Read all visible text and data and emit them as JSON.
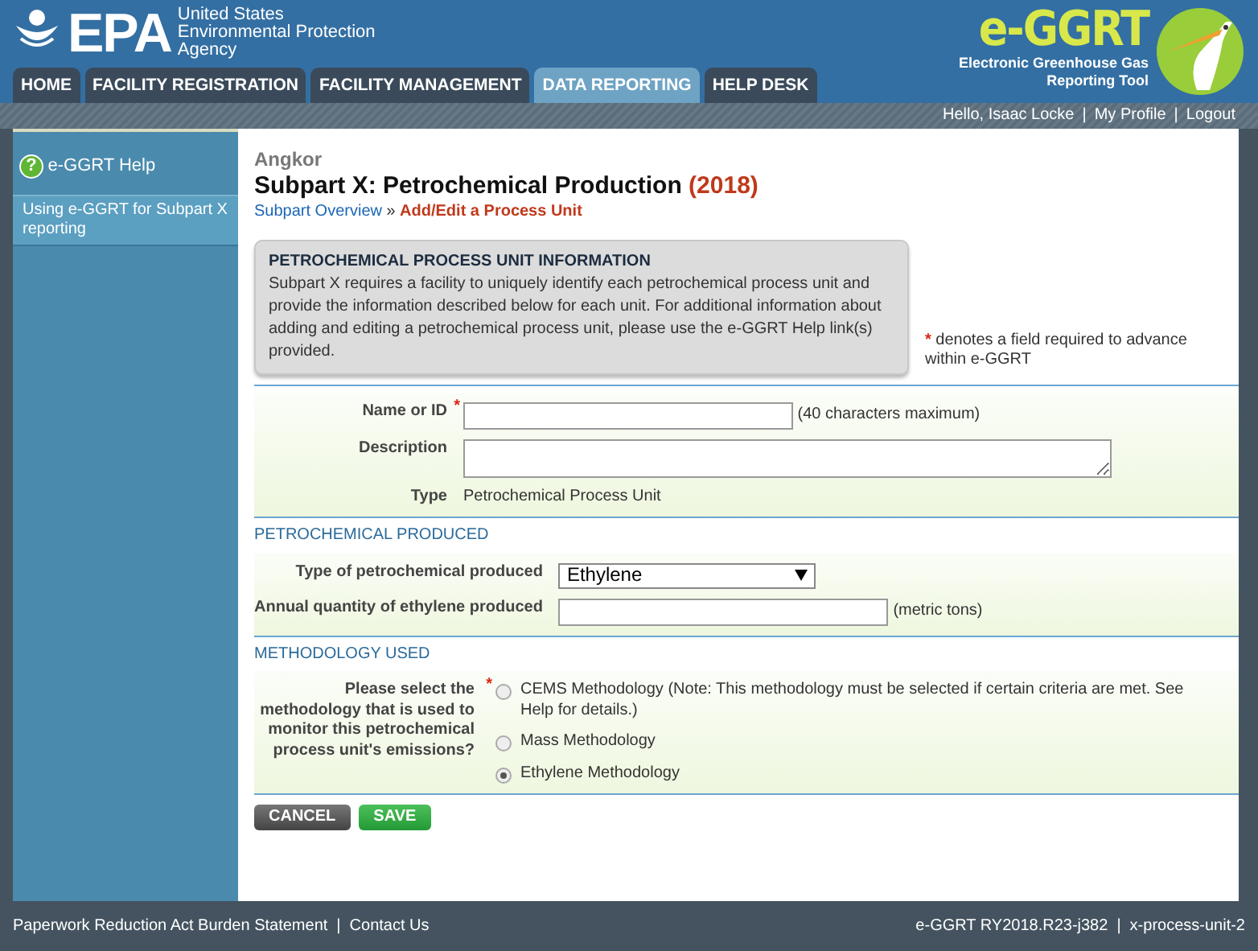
{
  "header": {
    "logo": "EPA",
    "agency": [
      "United States",
      "Environmental Protection",
      "Agency"
    ],
    "brand": "e-GGRT",
    "brand_sub": [
      "Electronic Greenhouse Gas",
      "Reporting Tool"
    ]
  },
  "tabs": [
    {
      "label": "HOME",
      "selected": false
    },
    {
      "label": "FACILITY REGISTRATION",
      "selected": false
    },
    {
      "label": "FACILITY MANAGEMENT",
      "selected": false
    },
    {
      "label": "DATA REPORTING",
      "selected": true
    },
    {
      "label": "HELP DESK",
      "selected": false
    }
  ],
  "user_bar": {
    "separator": "|",
    "items": [
      "Hello, Isaac Locke",
      "My Profile",
      "Logout"
    ]
  },
  "sidebar": {
    "help_icon": "?",
    "title": "e-GGRT Help",
    "items": [
      {
        "label": "Using e-GGRT for Subpart X reporting",
        "selected": true
      }
    ]
  },
  "page": {
    "facility": "Angkor",
    "title": "Subpart X: Petrochemical Production",
    "year": "(2018)",
    "breadcrumb": [
      "Subpart Overview",
      "Add/Edit a Process Unit"
    ],
    "breadcrumb_separator": "»"
  },
  "info_box": {
    "title": "PETROCHEMICAL PROCESS UNIT INFORMATION",
    "text": "Subpart X requires a facility to uniquely identify each petrochemical process unit and provide the information described below for each unit. For additional information about adding and editing a petrochemical process unit, please use the e-GGRT Help link(s) provided."
  },
  "required_note": {
    "mark": "*",
    "text": "denotes a field required to advance within e-GGRT"
  },
  "required_mark": "*",
  "sections": [
    {
      "fields": [
        {
          "kind": "text",
          "label": "Name or ID",
          "required": true,
          "hint": "(40 characters maximum)"
        },
        {
          "kind": "textarea",
          "label": "Description",
          "required": false
        },
        {
          "kind": "static",
          "label": "Type",
          "required": false,
          "value": "Petrochemical Process Unit"
        }
      ]
    },
    {
      "title": "PETROCHEMICAL PRODUCED",
      "fields": [
        {
          "kind": "select",
          "label": "Type of petrochemical produced",
          "required": false,
          "value": "Ethylene"
        },
        {
          "kind": "text",
          "label": "Annual quantity of ethylene produced",
          "required": false,
          "hint": "(metric tons)"
        }
      ]
    },
    {
      "title": "METHODOLOGY USED",
      "fields": [
        {
          "kind": "radio",
          "label": "Please select the methodology that is used to monitor this petrochemical process unit's emissions?",
          "required": true,
          "options": [
            {
              "label": "CEMS Methodology (Note: This methodology must be selected if certain criteria are met. See Help for details.)",
              "selected": false
            },
            {
              "label": "Mass Methodology",
              "selected": false
            },
            {
              "label": "Ethylene Methodology",
              "selected": true
            }
          ]
        }
      ]
    }
  ],
  "buttons": [
    {
      "kind": "cancel",
      "label": "CANCEL"
    },
    {
      "kind": "save",
      "label": "SAVE"
    }
  ],
  "footer": {
    "separator": "|",
    "left": [
      "Paperwork Reduction Act Burden Statement",
      "Contact Us"
    ],
    "right": [
      "e-GGRT RY2018.R23-j382",
      "x-process-unit-2"
    ]
  }
}
